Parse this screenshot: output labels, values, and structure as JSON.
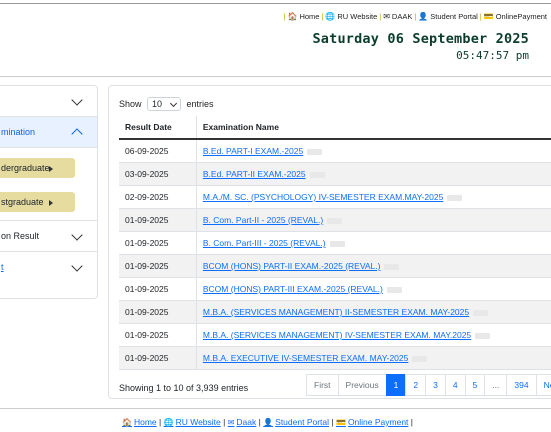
{
  "top_links": [
    {
      "icon": "home-icon",
      "glyph": "🏠",
      "label": "Home"
    },
    {
      "icon": "globe-icon",
      "glyph": "🌐",
      "label": "RU Website"
    },
    {
      "icon": "envelope-icon",
      "glyph": "✉",
      "label": "DAAK"
    },
    {
      "icon": "user-icon",
      "glyph": "👤",
      "label": "Student Portal"
    },
    {
      "icon": "payment-icon",
      "glyph": "💳",
      "label": "OnlinePayment"
    }
  ],
  "header": {
    "date": "Saturday 06 September 2025",
    "time": "05:47:57 pm"
  },
  "sidebar": {
    "item0": "",
    "item1": "mination",
    "btn_under": "dergraduate",
    "btn_post": "stgraduate",
    "item2": "on Result",
    "item3": "t"
  },
  "table_controls": {
    "show": "Show",
    "entries_value": "10",
    "entries": "entries"
  },
  "table": {
    "headers": [
      "Result Date",
      "Examination Name"
    ],
    "rows": [
      {
        "date": "06-09-2025",
        "name": "B.Ed. PART-I EXAM.-2025"
      },
      {
        "date": "03-09-2025",
        "name": "B.Ed. PART-II EXAM.-2025"
      },
      {
        "date": "02-09-2025",
        "name": "M.A./M. SC. (PSYCHOLOGY) IV-SEMESTER EXAM.MAY-2025"
      },
      {
        "date": "01-09-2025",
        "name": "B. Com. Part-II - 2025 (REVAL.)"
      },
      {
        "date": "01-09-2025",
        "name": "B. Com. Part-III - 2025 (REVAL.)"
      },
      {
        "date": "01-09-2025",
        "name": "BCOM (HONS) PART-II EXAM.-2025 (REVAL.)"
      },
      {
        "date": "01-09-2025",
        "name": "BCOM (HONS) PART-III EXAM.-2025 (REVAL.)"
      },
      {
        "date": "01-09-2025",
        "name": "M.B.A. (SERVICES MANAGEMENT) II-SEMESTER EXAM. MAY-2025"
      },
      {
        "date": "01-09-2025",
        "name": "M.B.A. (SERVICES MANAGEMENT) IV-SEMESTER EXAM. MAY.2025"
      },
      {
        "date": "01-09-2025",
        "name": "M.B.A. EXECUTIVE IV-SEMESTER EXAM. MAY-2025"
      }
    ]
  },
  "info": "Showing 1 to 10 of 3,939 entries",
  "pager": {
    "first": "First",
    "previous": "Previous",
    "pages": [
      "1",
      "2",
      "3",
      "4",
      "5"
    ],
    "ellipsis": "...",
    "last_page": "394",
    "next": "Next"
  },
  "footer_links": [
    {
      "icon": "home-icon",
      "glyph": "🏠",
      "label": "Home"
    },
    {
      "icon": "globe-icon",
      "glyph": "🌐",
      "label": "RU Website"
    },
    {
      "icon": "envelope-icon",
      "glyph": "✉",
      "label": "Daak"
    },
    {
      "icon": "user-icon",
      "glyph": "👤",
      "label": "Student Portal"
    },
    {
      "icon": "payment-icon",
      "glyph": "💳",
      "label": "Online Payment"
    }
  ]
}
